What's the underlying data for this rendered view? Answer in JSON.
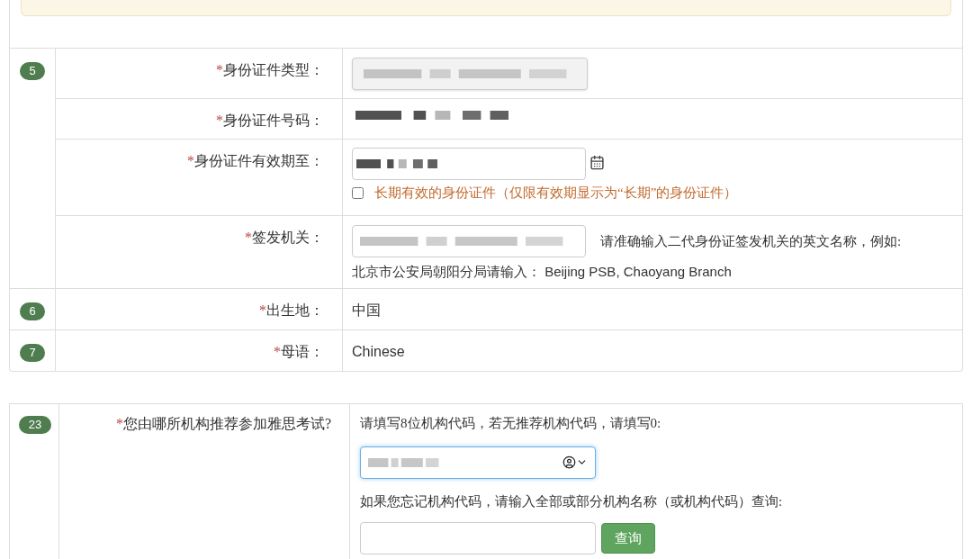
{
  "form": {
    "rows": [
      {
        "number": "5",
        "items": [
          {
            "kind": "select",
            "mark": "*",
            "label": "身份证件类型：",
            "redacted": true
          },
          {
            "kind": "text",
            "mark": "*",
            "label": "身份证件号码：",
            "redacted": true
          },
          {
            "kind": "date",
            "mark": "*",
            "label": "身份证件有效期至：",
            "redacted": true,
            "checkbox": {
              "label": "长期有效的身份证件（仅限有效期显示为“长期”的身份证件）",
              "checked": false
            }
          },
          {
            "kind": "input_hint",
            "mark": "*",
            "label": "签发机关：",
            "redacted": true,
            "hint": "请准确输入二代身份证签发机关的英文名称，例如:",
            "hint_2": "北京市公安局朝阳分局请输入： Beijing PSB, Chaoyang Branch"
          }
        ]
      },
      {
        "number": "6",
        "items": [
          {
            "kind": "value",
            "mark": "*",
            "label": "出生地：",
            "value": "中国"
          }
        ]
      },
      {
        "number": "7",
        "items": [
          {
            "kind": "value",
            "mark": "*",
            "label": "母语：",
            "value": "Chinese"
          }
        ]
      }
    ]
  },
  "referral": {
    "number": "23",
    "mark": "*",
    "label": "您由哪所机构推荐参加雅思考试?",
    "instruction": "请填写8位机构代码，若无推荐机构代码，请填写0:",
    "select": {
      "redacted": true
    },
    "search_hint": "如果您忘记机构代码，请输入全部或部分机构名称（或机构代码）查询:",
    "search_button": "查询"
  }
}
